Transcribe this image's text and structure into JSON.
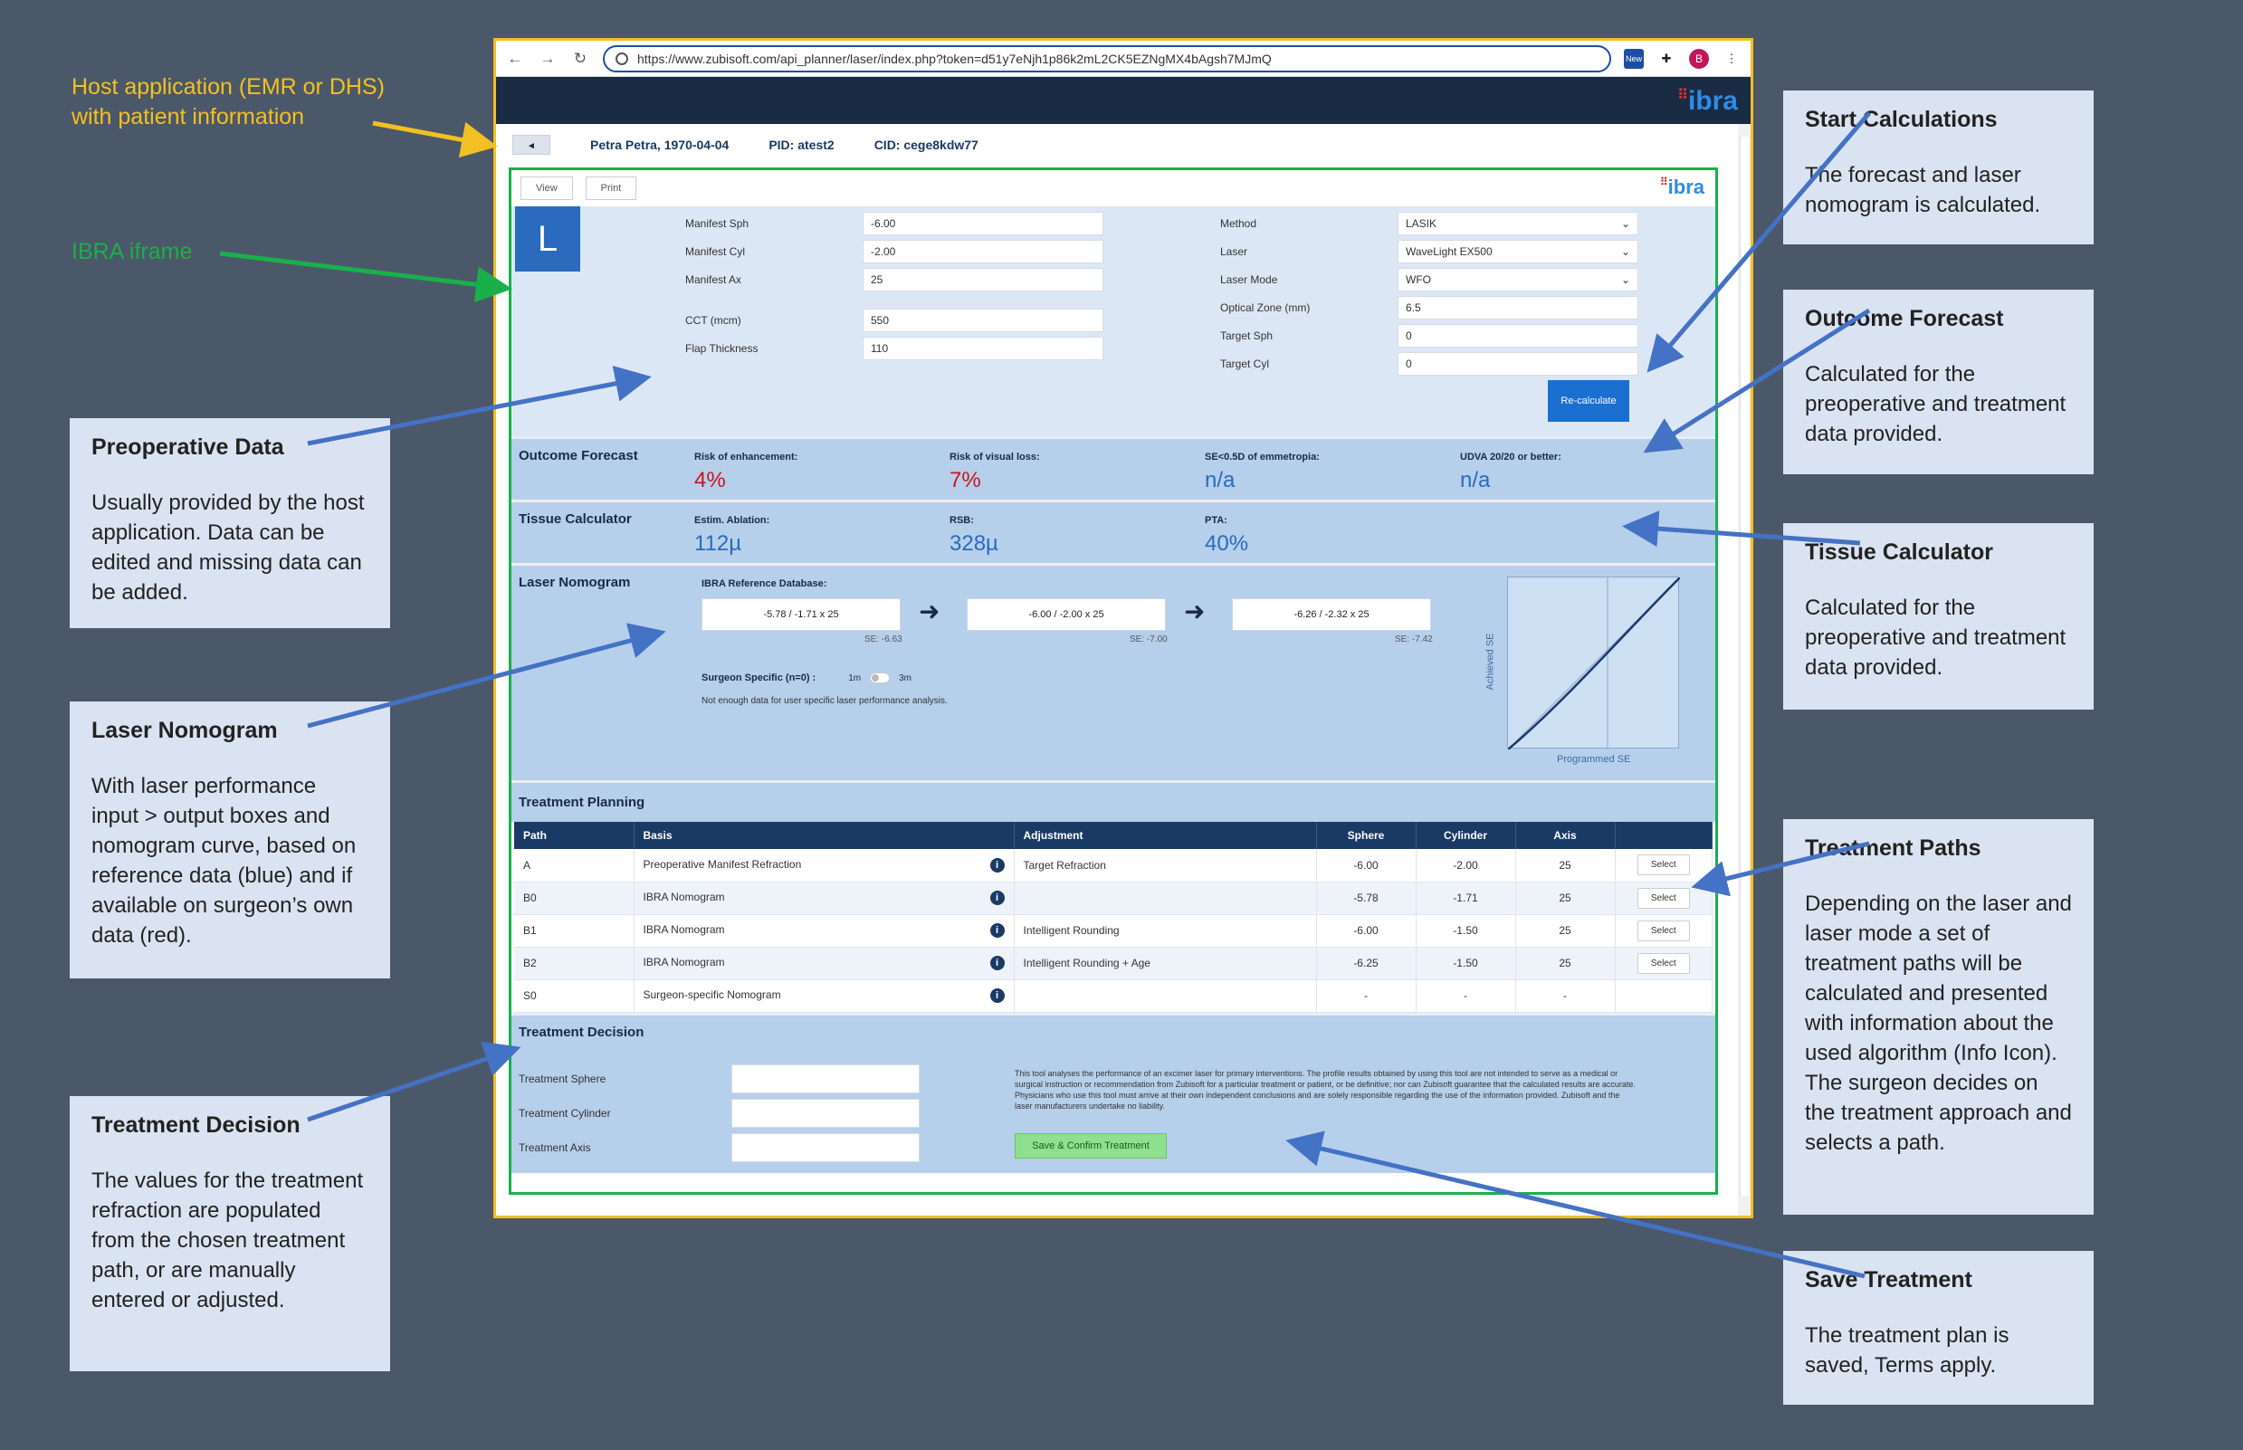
{
  "annotations": {
    "host_app": "Host application (EMR or DHS) with patient information",
    "iframe": "IBRA iframe",
    "callouts": [
      {
        "title": "Start Calculations",
        "text": "The forecast and laser nomogram is calculated."
      },
      {
        "title": "Outcome Forecast",
        "text": "Calculated for the preoperative and treatment data provided."
      },
      {
        "title": "Tissue Calculator",
        "text": "Calculated for the preoperative and treatment data provided."
      },
      {
        "title": "Treatment Paths",
        "text": "Depending on the laser and laser mode a set of treatment paths will be calculated and presented with information about the used algorithm (Info Icon). The surgeon decides on the treatment approach and selects a path."
      },
      {
        "title": "Save Treatment",
        "text": "The treatment plan is saved, Terms apply."
      },
      {
        "title": "Preoperative Data",
        "text": "Usually provided by the host application. Data can be edited and missing data can be added."
      },
      {
        "title": "Laser Nomogram",
        "text": "With laser performance input > output boxes and nomogram curve, based on reference data (blue) and if available on surgeon’s own data (red)."
      },
      {
        "title": "Treatment Decision",
        "text": "The values for the treatment refraction are populated from the chosen treatment path, or are manually entered or adjusted."
      }
    ]
  },
  "browser": {
    "url": "https://www.zubisoft.com/api_planner/laser/index.php?token=d51y7eNjh1p86k2mL2CK5EZNgMX4bAgsh7MJmQ",
    "ext_new": "New",
    "avatar": "B",
    "logo": "ibra"
  },
  "patient": {
    "back": "◂",
    "name": "Petra Petra, 1970-04-04",
    "pid": "PID: atest2",
    "cid": "CID: cege8kdw77"
  },
  "toolbar": {
    "view": "View",
    "print": "Print",
    "logo": "ibra"
  },
  "eye": "L",
  "preop": {
    "left": [
      {
        "label": "Manifest Sph",
        "value": "-6.00"
      },
      {
        "label": "Manifest Cyl",
        "value": "-2.00"
      },
      {
        "label": "Manifest Ax",
        "value": "25"
      },
      {
        "label": "CCT (mcm)",
        "value": "550"
      },
      {
        "label": "Flap Thickness",
        "value": "110"
      }
    ],
    "right": [
      {
        "label": "Method",
        "value": "LASIK"
      },
      {
        "label": "Laser",
        "value": "WaveLight EX500"
      },
      {
        "label": "Laser Mode",
        "value": "WFO"
      },
      {
        "label": "Optical Zone (mm)",
        "value": "6.5"
      },
      {
        "label": "Target Sph",
        "value": "0"
      },
      {
        "label": "Target Cyl",
        "value": "0"
      }
    ],
    "recalc": "Re-calculate"
  },
  "forecast": {
    "title": "Outcome Forecast",
    "metrics": [
      {
        "label": "Risk of enhancement:",
        "value": "4%"
      },
      {
        "label": "Risk of visual loss:",
        "value": "7%"
      },
      {
        "label": "SE<0.5D of emmetropia:",
        "value": "n/a"
      },
      {
        "label": "UDVA 20/20 or better:",
        "value": "n/a"
      }
    ]
  },
  "tissue": {
    "title": "Tissue Calculator",
    "metrics": [
      {
        "label": "Estim. Ablation:",
        "value": "112µ"
      },
      {
        "label": "RSB:",
        "value": "328µ"
      },
      {
        "label": "PTA:",
        "value": "40%"
      }
    ]
  },
  "nomogram": {
    "title": "Laser Nomogram",
    "ref_label": "IBRA Reference Database:",
    "boxes": [
      {
        "value": "-5.78 / -1.71 x 25",
        "se": "SE: -6.63"
      },
      {
        "value": "-6.00 / -2.00 x 25",
        "se": "SE: -7.00"
      },
      {
        "value": "-6.26 / -2.32 x 25",
        "se": "SE: -7.42"
      }
    ],
    "surgeon_label": "Surgeon Specific (n=0) :",
    "toggle_left": "1m",
    "toggle_right": "3m",
    "note": "Not enough data for user specific laser performance analysis.",
    "x_label": "Programmed SE",
    "y_label": "Achieved SE"
  },
  "planning": {
    "title": "Treatment Planning",
    "headers": [
      "Path",
      "Basis",
      "Adjustment",
      "Sphere",
      "Cylinder",
      "Axis",
      ""
    ],
    "select": "Select",
    "rows": [
      {
        "path": "A",
        "basis": "Preoperative Manifest Refraction",
        "adj": "Target Refraction",
        "sph": "-6.00",
        "cyl": "-2.00",
        "axis": "25",
        "select": true
      },
      {
        "path": "B0",
        "basis": "IBRA Nomogram",
        "adj": "",
        "sph": "-5.78",
        "cyl": "-1.71",
        "axis": "25",
        "select": true
      },
      {
        "path": "B1",
        "basis": "IBRA Nomogram",
        "adj": "Intelligent Rounding",
        "sph": "-6.00",
        "cyl": "-1.50",
        "axis": "25",
        "select": true
      },
      {
        "path": "B2",
        "basis": "IBRA Nomogram",
        "adj": "Intelligent Rounding + Age",
        "sph": "-6.25",
        "cyl": "-1.50",
        "axis": "25",
        "select": true
      },
      {
        "path": "S0",
        "basis": "Surgeon-specific Nomogram",
        "adj": "",
        "sph": "-",
        "cyl": "-",
        "axis": "-",
        "select": false
      }
    ]
  },
  "decision": {
    "title": "Treatment Decision",
    "fields": [
      "Treatment Sphere",
      "Treatment Cylinder",
      "Treatment Axis"
    ],
    "disclaimer": "This tool analyses the performance of an excimer laser for primary interventions. The profile results obtained by using this tool are not intended to serve as a medical or surgical instruction or recommendation from Zubisoft for a particular treatment or patient, or be definitive; nor can Zubisoft guarantee that the calculated results are accurate. Physicians who use this tool must arrive at their own independent conclusions and are solely responsible regarding the use of the information provided. Zubisoft and the laser manufacturers undertake no liability.",
    "save": "Save & Confirm Treatment"
  },
  "colors": {
    "accent": "#1a6fd1",
    "header": "#1a2b44",
    "host": "#f2c022",
    "iframe": "#19b04b",
    "arrow": "#4472c4",
    "risk": "#c4161c"
  }
}
